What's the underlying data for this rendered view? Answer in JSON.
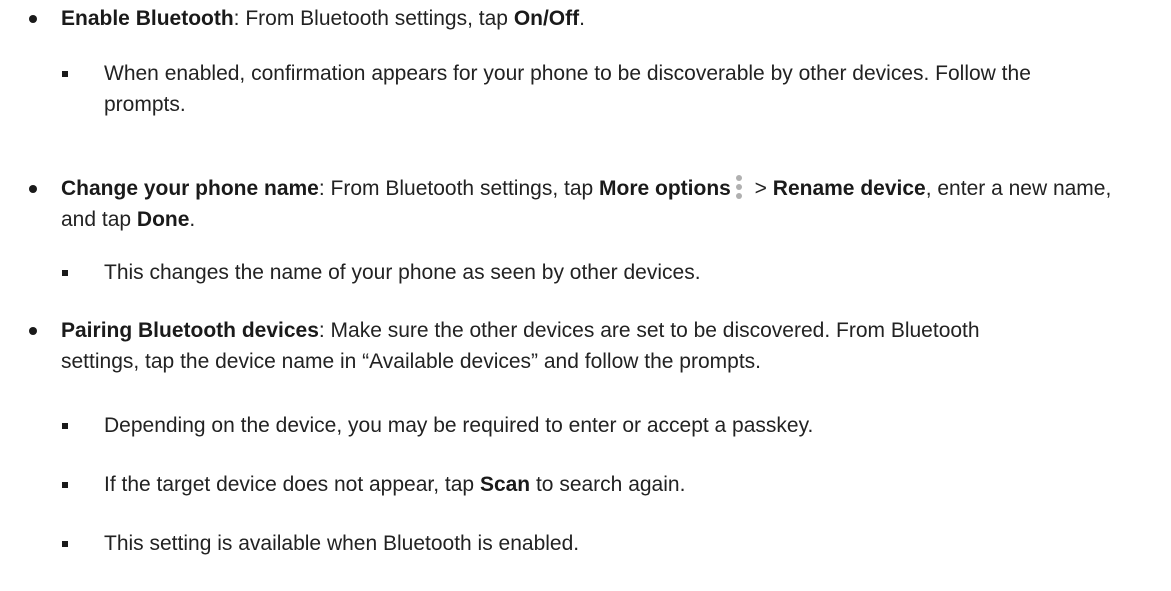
{
  "items": [
    {
      "bold": "Enable Bluetooth",
      "text": ": From Bluetooth settings, tap ",
      "bold2": "On/Off",
      "end": ".",
      "sub": [
        {
          "text": "When enabled, confirmation appears for your phone to be discoverable by other devices. Follow the prompts."
        }
      ]
    },
    {
      "bold": "Change your phone name",
      "text": ": From Bluetooth settings, tap ",
      "bold2": "More options",
      "sep": " > ",
      "bold3": "Rename device",
      "text2": ", enter a new name, and tap ",
      "bold4": "Done",
      "end": ".",
      "icon": "more-options-icon",
      "sub": [
        {
          "text": "This changes the name of your phone as seen by other devices."
        }
      ]
    },
    {
      "bold": "Pairing Bluetooth devices",
      "text": ": Make sure the other devices are set to be discovered. From Bluetooth settings, tap the device name in “Available devices” and follow the prompts.",
      "sub": [
        {
          "text": "Depending on the device, you may be required to enter or accept a passkey."
        },
        {
          "pre": "If the target device does not appear, tap ",
          "bold": "Scan",
          "post": " to search again."
        },
        {
          "text": "This setting is available when Bluetooth is enabled."
        }
      ]
    }
  ]
}
